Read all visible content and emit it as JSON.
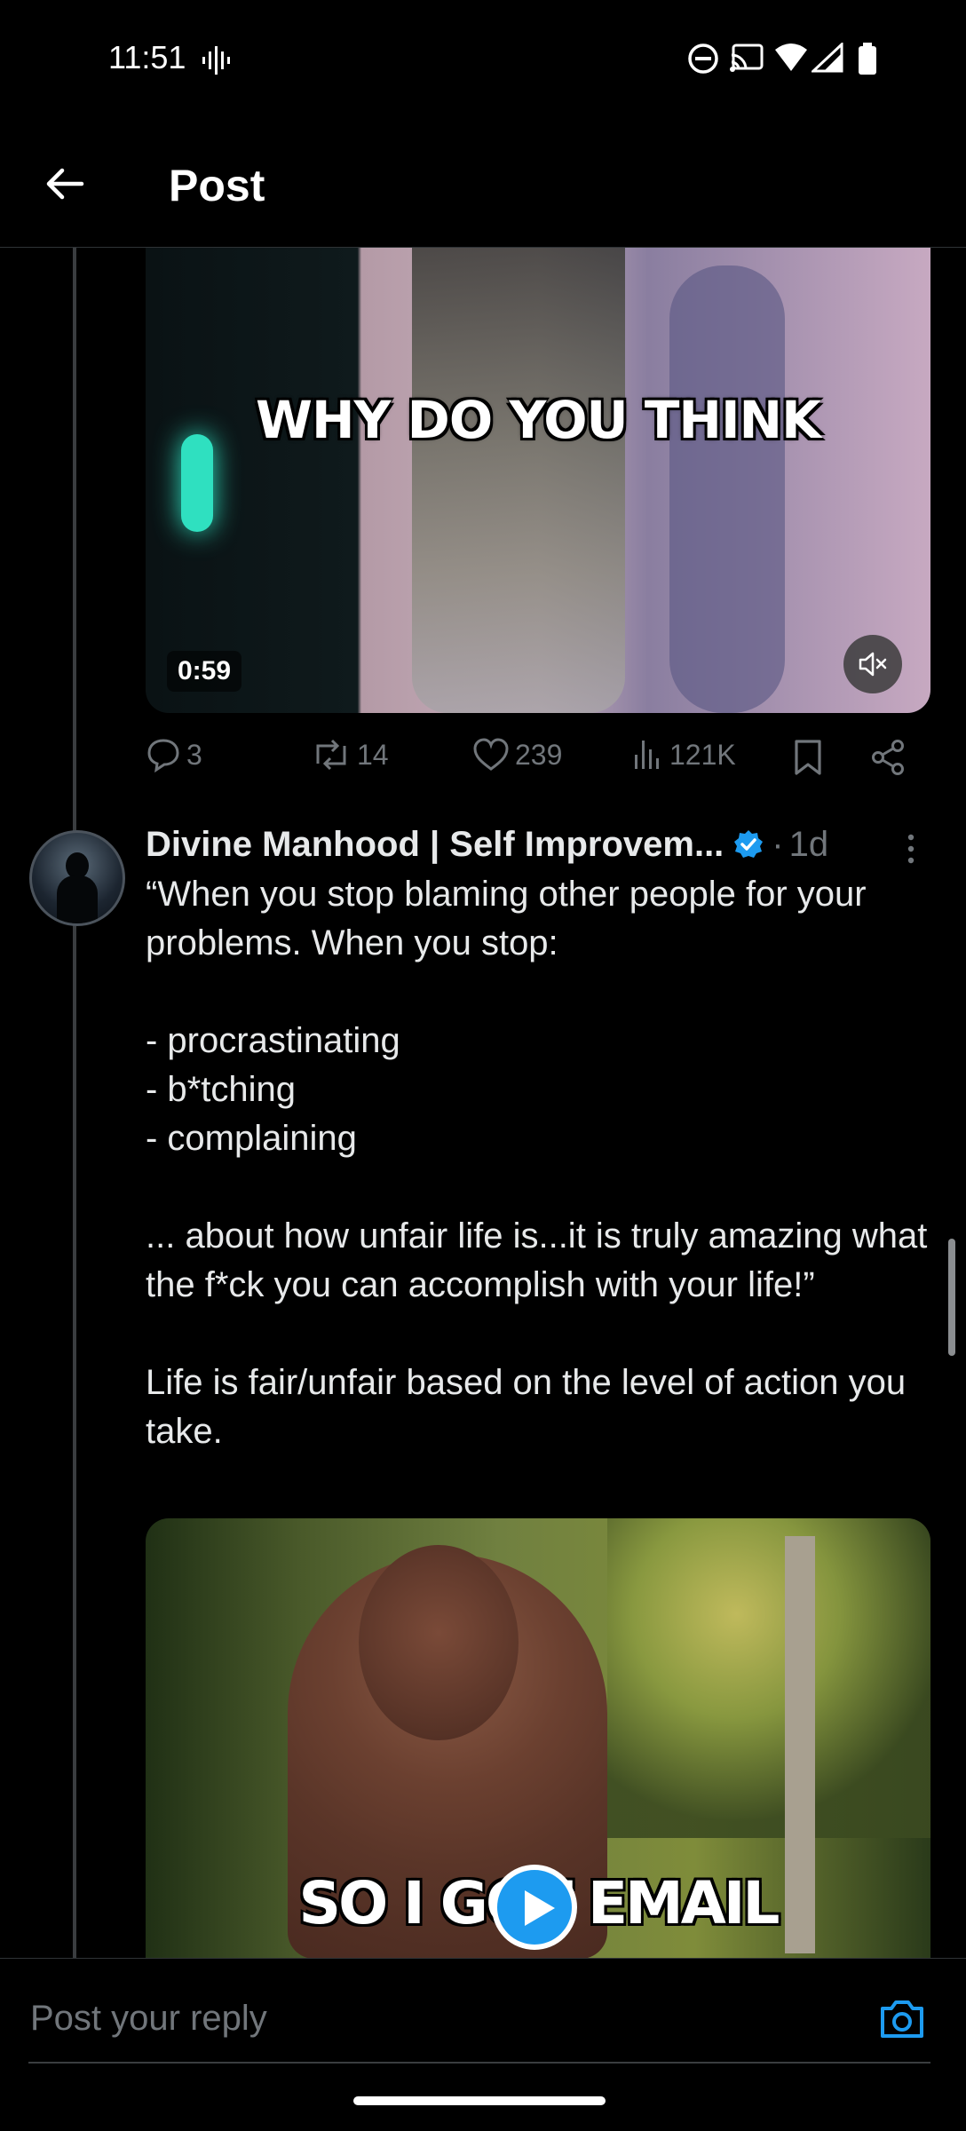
{
  "status_bar": {
    "time": "11:51"
  },
  "header": {
    "title": "Post"
  },
  "media1": {
    "caption": "WHY DO YOU THINK",
    "duration": "0:59"
  },
  "actions": {
    "replies": "3",
    "reposts": "14",
    "likes": "239",
    "views": "121K"
  },
  "reply_post": {
    "author": "Divine Manhood | Self Improvem...",
    "separator": "·",
    "time_ago": "1d",
    "lines": [
      "“When you stop blaming other people for your problems. When you stop:",
      "",
      "- procrastinating",
      "- b*tching",
      "- complaining",
      "",
      "... about how unfair life is...it is truly amazing what the f*ck you can accomplish with your life!”",
      "",
      "Life is fair/unfair based on the level of action you take."
    ]
  },
  "media2": {
    "caption": "SO I GOT EMAIL"
  },
  "compose": {
    "placeholder": "Post your reply"
  },
  "colors": {
    "accent": "#1d9bf0",
    "background": "#000000",
    "muted": "#71767b",
    "text": "#e7e9ea"
  }
}
